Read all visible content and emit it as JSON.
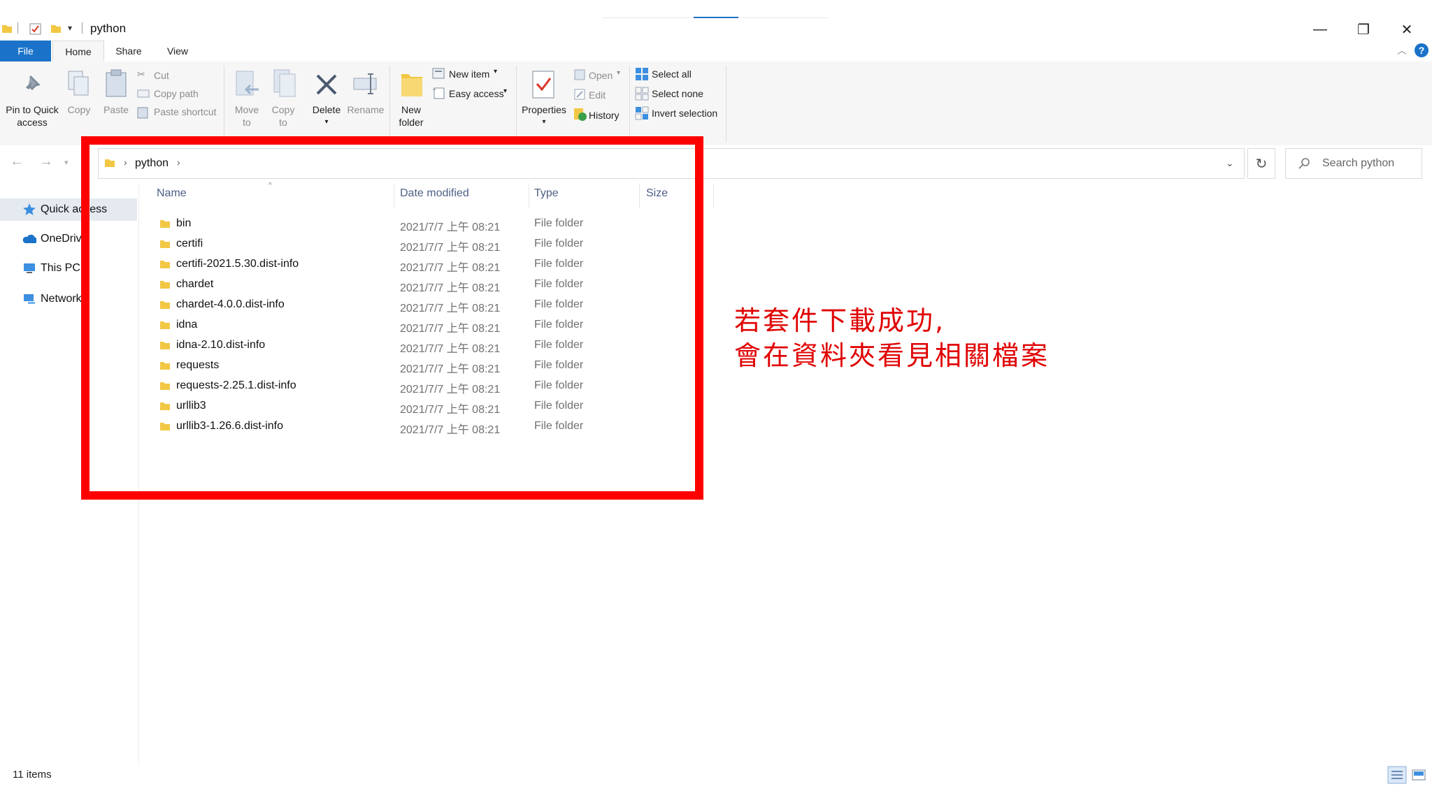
{
  "window": {
    "title": "python",
    "minimize_glyph": "—",
    "restore_glyph": "❐",
    "close_glyph": "✕"
  },
  "ribbon_tabs": {
    "file": "File",
    "home": "Home",
    "share": "Share",
    "view": "View"
  },
  "ribbon": {
    "pin_to_quick_access": [
      "Pin to Quick",
      "access"
    ],
    "copy": "Copy",
    "paste": "Paste",
    "cut": "Cut",
    "copy_path": "Copy path",
    "paste_shortcut": "Paste shortcut",
    "move_to": [
      "Move",
      "to"
    ],
    "copy_to": [
      "Copy",
      "to"
    ],
    "delete": "Delete",
    "rename": "Rename",
    "new_folder": [
      "New",
      "folder"
    ],
    "new_item": "New item",
    "easy_access": "Easy access",
    "properties": "Properties",
    "open": "Open",
    "edit": "Edit",
    "history": "History",
    "select_all": "Select all",
    "select_none": "Select none",
    "invert_selection": "Invert selection"
  },
  "address": {
    "breadcrumb": [
      "python"
    ],
    "search_placeholder": "Search python"
  },
  "nav_pane": {
    "items": [
      {
        "label": "Quick access",
        "icon": "star-icon",
        "selected": true
      },
      {
        "label": "OneDrive",
        "icon": "cloud-icon"
      },
      {
        "label": "This PC",
        "icon": "computer-icon"
      },
      {
        "label": "Network",
        "icon": "network-icon"
      }
    ]
  },
  "file_list": {
    "columns": [
      "Name",
      "Date modified",
      "Type",
      "Size"
    ],
    "rows": [
      {
        "name": "bin",
        "date": "2021/7/7 上午 08:21",
        "type": "File folder"
      },
      {
        "name": "certifi",
        "date": "2021/7/7 上午 08:21",
        "type": "File folder"
      },
      {
        "name": "certifi-2021.5.30.dist-info",
        "date": "2021/7/7 上午 08:21",
        "type": "File folder"
      },
      {
        "name": "chardet",
        "date": "2021/7/7 上午 08:21",
        "type": "File folder"
      },
      {
        "name": "chardet-4.0.0.dist-info",
        "date": "2021/7/7 上午 08:21",
        "type": "File folder"
      },
      {
        "name": "idna",
        "date": "2021/7/7 上午 08:21",
        "type": "File folder"
      },
      {
        "name": "idna-2.10.dist-info",
        "date": "2021/7/7 上午 08:21",
        "type": "File folder"
      },
      {
        "name": "requests",
        "date": "2021/7/7 上午 08:21",
        "type": "File folder"
      },
      {
        "name": "requests-2.25.1.dist-info",
        "date": "2021/7/7 上午 08:21",
        "type": "File folder"
      },
      {
        "name": "urllib3",
        "date": "2021/7/7 上午 08:21",
        "type": "File folder"
      },
      {
        "name": "urllib3-1.26.6.dist-info",
        "date": "2021/7/7 上午 08:21",
        "type": "File folder"
      }
    ]
  },
  "status_bar": {
    "item_count": "11 items"
  },
  "annotation": {
    "line1": "若套件下載成功,",
    "line2": "會在資料夾看見相關檔案",
    "color": "#ff0000"
  },
  "colors": {
    "accent": "#1a73c8",
    "folder": "#f2c744"
  }
}
